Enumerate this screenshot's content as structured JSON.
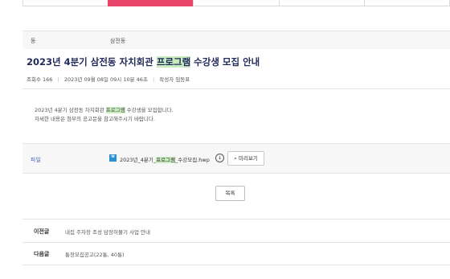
{
  "tabs": [
    "",
    "",
    "",
    "",
    ""
  ],
  "meta": {
    "dong_label": "동",
    "dong_value": "삼전동"
  },
  "post": {
    "title_before": "2023년 4분기 삼전동 자치회관 ",
    "title_highlight": "프로그램",
    "title_after": " 수강생 모집 안내",
    "views_label": "조회수",
    "views": "166",
    "date": "2023년 09월 08일 09시 10분 46초",
    "author_label": "작성자",
    "author": "임동표",
    "body_line1_before": "2023년 4분기 삼전동 자치회관 ",
    "body_line1_highlight": "프로그램",
    "body_line1_after": " 수강생을 모집합니다.",
    "body_line2": "자세한 내용은 첨부의 공고문을 참고해주시기 바랍니다."
  },
  "attachment": {
    "label": "파일",
    "name_before": "2023년_4분기_",
    "name_highlight": "프로그램",
    "name_after": "_수강모집.hwp",
    "preview_label": "미리보기"
  },
  "list_button": "목록",
  "prev": {
    "label": "이전글",
    "title": "내집 주차장 조성 담장허물기 사업 안내"
  },
  "next": {
    "label": "다음글",
    "title": "통장모집공고(22통, 40통)"
  },
  "colors": {
    "active_tab": "#e8456b",
    "title": "#1f2a5a",
    "highlight": "#c9ecbf",
    "file_label": "#4a6fb5"
  }
}
